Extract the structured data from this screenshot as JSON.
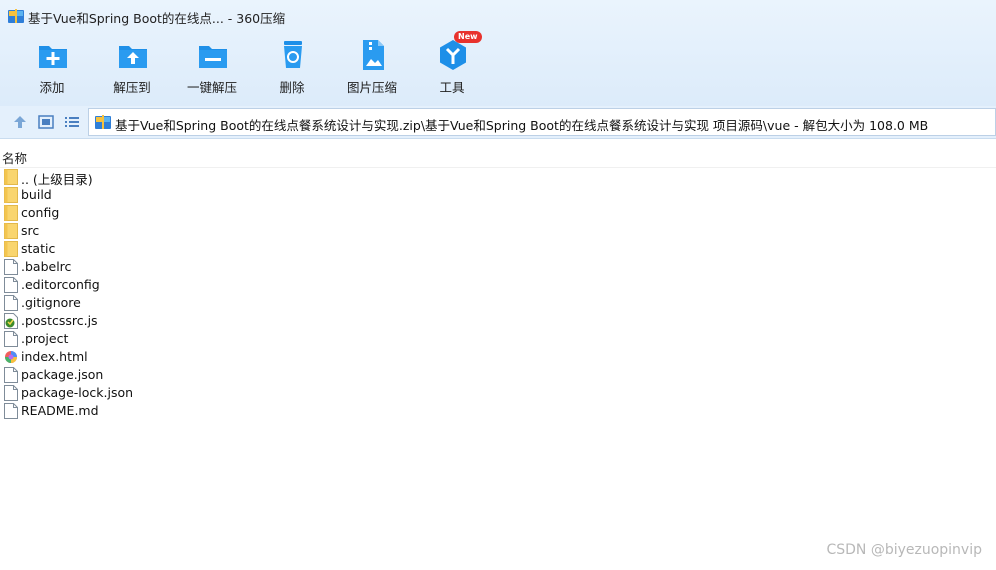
{
  "window": {
    "title": "基于Vue和Spring Boot的在线点... - 360压缩",
    "app_icon": "archive-icon"
  },
  "toolbar": {
    "items": [
      {
        "label": "添加",
        "icon": "add-folder-icon"
      },
      {
        "label": "解压到",
        "icon": "extract-folder-icon"
      },
      {
        "label": "一键解压",
        "icon": "quick-extract-icon"
      },
      {
        "label": "删除",
        "icon": "trash-icon"
      },
      {
        "label": "图片压缩",
        "icon": "image-compress-icon"
      },
      {
        "label": "工具",
        "icon": "tools-icon",
        "badge": "New"
      }
    ]
  },
  "address": {
    "path": "基于Vue和Spring Boot的在线点餐系统设计与实现.zip\\基于Vue和Spring Boot的在线点餐系统设计与实现 项目源码\\vue - 解包大小为 108.0 MB"
  },
  "columns": {
    "name": "名称"
  },
  "files": [
    {
      "name": ".. (上级目录)",
      "type": "folder"
    },
    {
      "name": "build",
      "type": "folder"
    },
    {
      "name": "config",
      "type": "folder"
    },
    {
      "name": "src",
      "type": "folder"
    },
    {
      "name": "static",
      "type": "folder"
    },
    {
      "name": ".babelrc",
      "type": "file"
    },
    {
      "name": ".editorconfig",
      "type": "file"
    },
    {
      "name": ".gitignore",
      "type": "file"
    },
    {
      "name": ".postcssrc.js",
      "type": "js"
    },
    {
      "name": ".project",
      "type": "file"
    },
    {
      "name": "index.html",
      "type": "html"
    },
    {
      "name": "package.json",
      "type": "file"
    },
    {
      "name": "package-lock.json",
      "type": "file"
    },
    {
      "name": "README.md",
      "type": "file"
    }
  ],
  "watermark": "CSDN @biyezuopinvip",
  "colors": {
    "accent": "#1e8fe8",
    "folder": "#f9d56e",
    "badge": "#e8322d"
  }
}
